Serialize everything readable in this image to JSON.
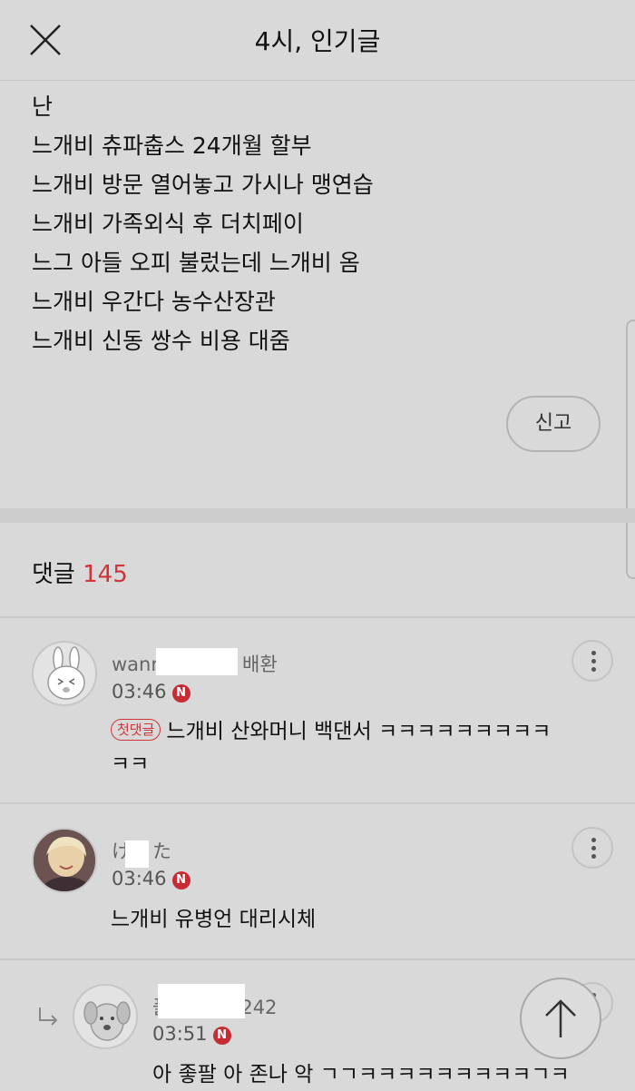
{
  "header": {
    "title": "4시, 인기글",
    "close_icon": "close-icon"
  },
  "post": {
    "lines": [
      "난",
      "느개비 츄파춥스 24개월 할부",
      "느개비 방문 열어놓고 가시나 맹연습",
      "느개비 가족외식 후 더치페이",
      "느그 아들 오피 불렀는데 느개비 옴",
      "느개비 우간다 농수산장관",
      "느개비 신동 쌍수 비용 대줌"
    ],
    "report_label": "신고"
  },
  "comments": {
    "label": "댓글",
    "count": "145",
    "items": [
      {
        "author_prefix": "wanr",
        "author_suffix": "배환",
        "time": "03:46",
        "badge": "N",
        "tag": "첫댓글",
        "text_line1": "느개비 산와머니 백댄서 ㅋㅋㅋㅋㅋㅋㅋㅋㅋ",
        "text_line2": "ㅋㅋ"
      },
      {
        "author_prefix": "け",
        "author_suffix": "た",
        "time": "03:46",
        "badge": "N",
        "text": "느개비 유병언 대리시체"
      },
      {
        "author_prefix": "풀",
        "author_suffix": "242",
        "time": "03:51",
        "badge": "N",
        "text": "아 좋팔 아 존나 악 ㄱㄱㅋㅋㅋㅋㅋㅋㅋㅋㅋㄱㅋ"
      }
    ]
  },
  "colors": {
    "accent": "#d0343a",
    "background": "#d9d9d9"
  }
}
